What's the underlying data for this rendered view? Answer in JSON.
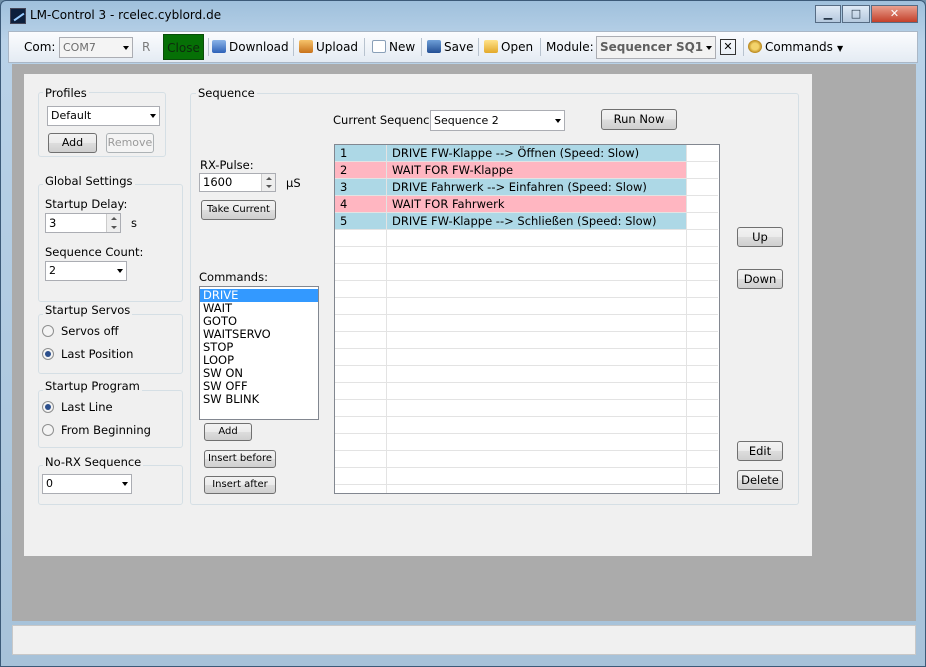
{
  "window": {
    "title": "LM-Control 3 - rcelec.cyblord.de",
    "minimize": "▁",
    "maximize": "□",
    "close": "✕"
  },
  "toolbar": {
    "com_label": "Com:",
    "com_value": "COM7",
    "r_label": "R",
    "close_label": "Close",
    "download_label": "Download",
    "upload_label": "Upload",
    "new_label": "New",
    "save_label": "Save",
    "open_label": "Open",
    "module_label": "Module:",
    "module_value": "Sequencer SQ1",
    "module_close": "✕",
    "commands_label": "Commands"
  },
  "profiles": {
    "title": "Profiles",
    "value": "Default",
    "add": "Add",
    "remove": "Remove"
  },
  "global": {
    "title": "Global Settings",
    "startup_delay_label": "Startup Delay:",
    "startup_delay_value": "3",
    "unit": "s",
    "sequence_count_label": "Sequence Count:",
    "sequence_count_value": "2"
  },
  "servos": {
    "title": "Startup Servos",
    "off": "Servos off",
    "last": "Last Position",
    "selected": "last"
  },
  "program": {
    "title": "Startup Program",
    "last": "Last Line",
    "begin": "From Beginning",
    "selected": "last"
  },
  "norx": {
    "title": "No-RX Sequence",
    "value": "0"
  },
  "sequence": {
    "title": "Sequence",
    "current_label": "Current Sequence",
    "current_value": "Sequence 2",
    "run_now": "Run Now",
    "rx_label": "RX-Pulse:",
    "rx_value": "1600",
    "rx_unit": "µS",
    "take_current": "Take Current",
    "commands_label": "Commands:",
    "commands": [
      "DRIVE",
      "WAIT",
      "GOTO",
      "WAITSERVO",
      "STOP",
      "LOOP",
      "SW ON",
      "SW OFF",
      "SW BLINK"
    ],
    "selected_command": 0,
    "add": "Add",
    "insert_before": "Insert before",
    "insert_after": "Insert after",
    "up": "Up",
    "down": "Down",
    "edit": "Edit",
    "delete": "Delete",
    "rows": [
      {
        "num": "1",
        "text": "DRIVE FW-Klappe --> Öffnen (Speed: Slow)",
        "color": "#add8e6"
      },
      {
        "num": "2",
        "text": "WAIT FOR FW-Klappe",
        "color": "#ffb6c1"
      },
      {
        "num": "3",
        "text": "DRIVE Fahrwerk --> Einfahren (Speed: Slow)",
        "color": "#add8e6"
      },
      {
        "num": "4",
        "text": "WAIT FOR Fahrwerk",
        "color": "#ffb6c1"
      },
      {
        "num": "5",
        "text": "DRIVE FW-Klappe --> Schließen (Speed: Slow)",
        "color": "#add8e6"
      }
    ]
  }
}
